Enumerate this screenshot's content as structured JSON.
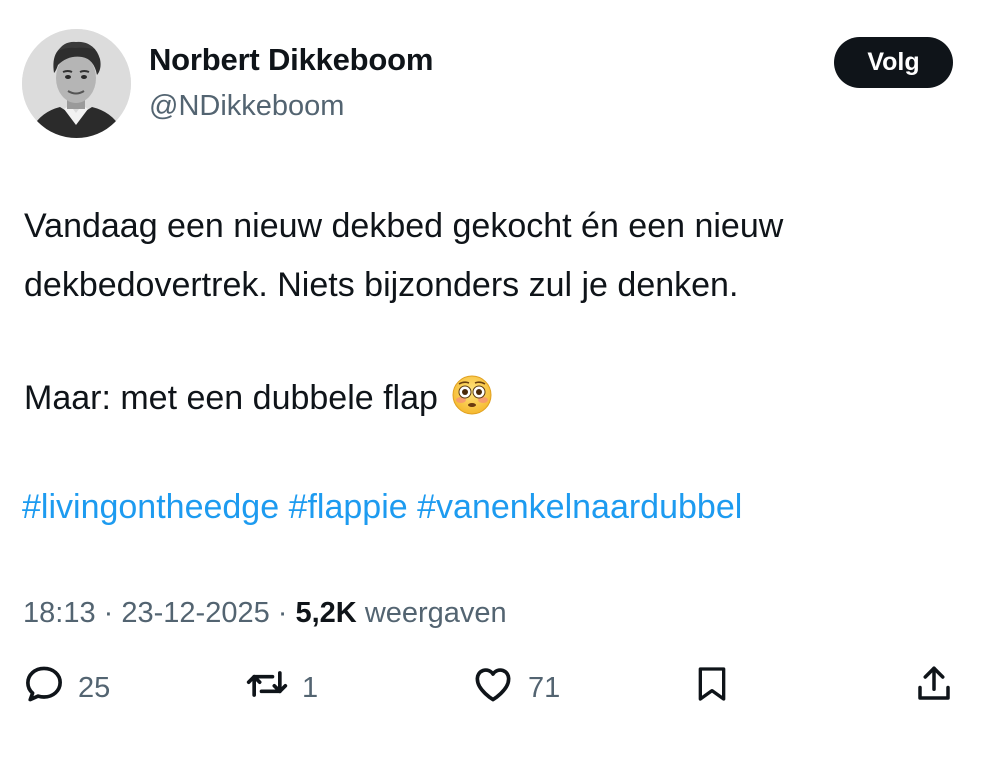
{
  "author": {
    "name": "Norbert Dikkeboom",
    "handle": "@NDikkeboom",
    "follow_label": "Volg"
  },
  "tweet": {
    "line1": "Vandaag een nieuw dekbed gekocht én een nieuw",
    "line2": "dekbedovertrek. Niets bijzonders zul je denken.",
    "line3": "Maar: met een dubbele flap",
    "emoji": "flushed-face-emoji",
    "hashtags": [
      "#livingontheedge",
      "#flappie",
      "#vanenkelnaardubbel"
    ]
  },
  "meta": {
    "time": "18:13",
    "date": "23-12-2025",
    "views_count": "5,2K",
    "views_label": "weergaven"
  },
  "actions": {
    "reply_count": "25",
    "retweet_count": "1",
    "like_count": "71"
  },
  "colors": {
    "text": "#0f1419",
    "secondary": "#536471",
    "link": "#1d9bf0",
    "button_bg": "#0f1419"
  },
  "icons": {
    "reply": "speech-bubble-icon",
    "retweet": "retweet-arrows-icon",
    "like": "heart-icon",
    "bookmark": "bookmark-icon",
    "share": "share-upload-icon"
  }
}
